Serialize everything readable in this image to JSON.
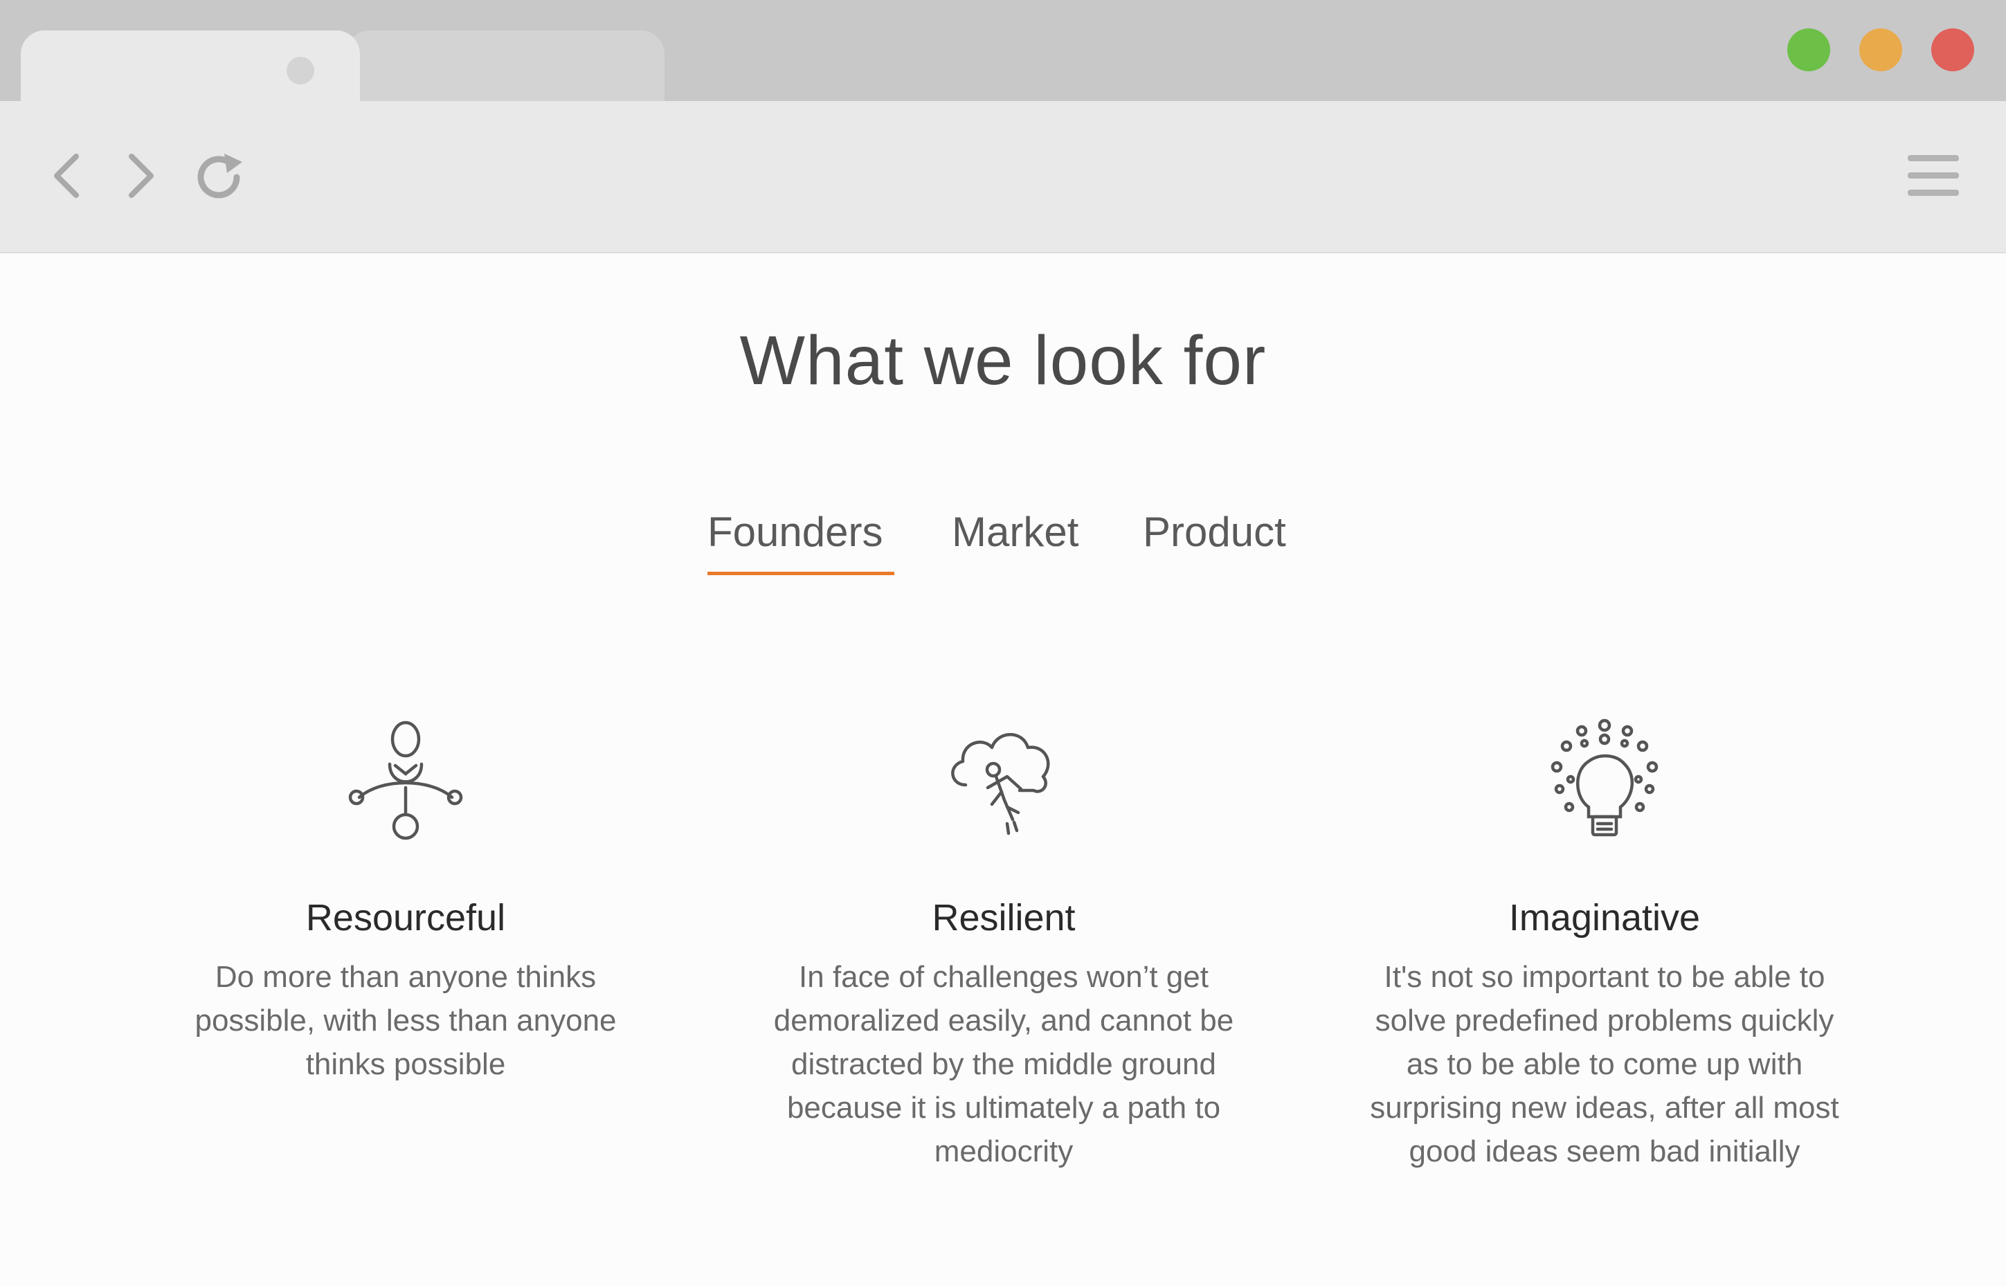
{
  "window": {
    "traffic_lights": [
      {
        "name": "green",
        "color": "#6cbf47"
      },
      {
        "name": "yellow",
        "color": "#e9aa4c"
      },
      {
        "name": "red",
        "color": "#e0605a"
      }
    ],
    "toolbar_icons": [
      "back-icon",
      "forward-icon",
      "reload-icon",
      "menu-icon"
    ]
  },
  "page": {
    "title": "What we look for",
    "accent_color": "#ea7a2a",
    "tabs": [
      {
        "label": "Founders",
        "active": true
      },
      {
        "label": "Market",
        "active": false
      },
      {
        "label": "Product",
        "active": false
      }
    ],
    "cards": [
      {
        "icon": "person-network-icon",
        "title": "Resourceful",
        "lines": [
          "Do more than anyone thinks",
          "possible, with less than anyone",
          "thinks possible"
        ]
      },
      {
        "icon": "cloud-climber-icon",
        "title": "Resilient",
        "lines": [
          "In face of challenges won’t get",
          "demoralized easily, and cannot be",
          "distracted by the middle ground",
          "because it is ultimately a path to",
          "mediocrity"
        ]
      },
      {
        "icon": "lightbulb-idea-icon",
        "title": "Imaginative",
        "lines": [
          "It's not so important to be able to",
          "solve predefined problems quickly",
          "as to be able to come up with",
          "surprising new ideas, after all most",
          "good ideas seem bad initially"
        ]
      }
    ]
  }
}
